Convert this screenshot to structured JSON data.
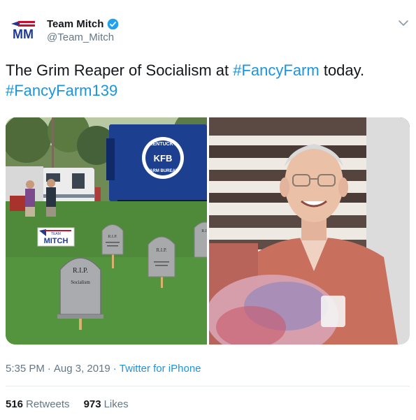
{
  "author": {
    "display_name": "Team Mitch",
    "handle": "@Team_Mitch",
    "avatar_text": "MM",
    "verified": true
  },
  "tweet": {
    "text_before": "The Grim Reaper of Socialism at ",
    "hashtag_1": "#FancyFarm",
    "text_after": " today.",
    "hashtag_2": "#FancyFarm139"
  },
  "photos": {
    "left": {
      "truck_sign_top": "KENTUCKY",
      "truck_sign_center": "KFB",
      "truck_sign_bottom": "FARM BUREAU",
      "yard_sign_small": "TEAM",
      "yard_sign_main": "MITCH",
      "gravestone_1_title": "R.I.P.",
      "gravestone_1_text": "Socialism",
      "gravestone_2_title": "R.I.P.",
      "gravestone_3_title": "R.I.P.",
      "gravestone_4_title": "R.I"
    }
  },
  "meta": {
    "time": "5:35 PM",
    "separator": "·",
    "date": "Aug 3, 2019",
    "source": "Twitter for iPhone"
  },
  "stats": {
    "retweets_count": "516",
    "retweets_label": "Retweets",
    "likes_count": "973",
    "likes_label": "Likes"
  },
  "colors": {
    "link": "#1b95e0",
    "secondary_text": "#657786",
    "verified_badge": "#1da1f2",
    "brand_red": "#c8102e",
    "brand_blue": "#1f3a93"
  }
}
